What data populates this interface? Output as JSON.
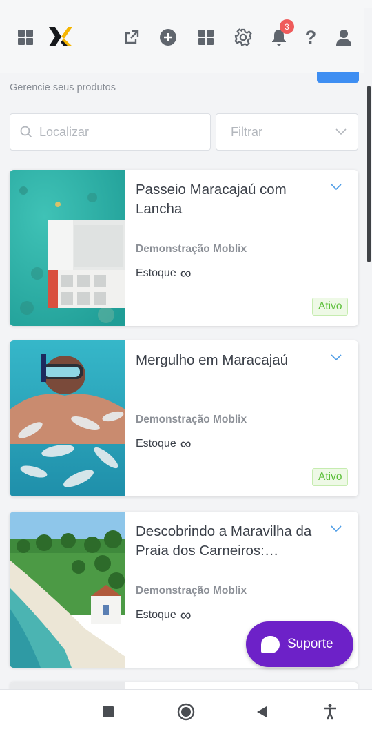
{
  "header": {
    "icons": [
      "apps-grid-icon",
      "moblix-logo",
      "external-link-icon",
      "add-circle-icon",
      "modules-grid-icon",
      "settings-gear-icon",
      "bell-icon",
      "help-icon",
      "user-icon"
    ],
    "notification_count": "3",
    "help_label": "?"
  },
  "page": {
    "subtitle": "Gerencie seus produtos"
  },
  "search": {
    "placeholder": "Localizar",
    "value": ""
  },
  "filter": {
    "placeholder": "Filtrar"
  },
  "products": [
    {
      "title": "Passeio Maracajaú com Lancha",
      "brand": "Demonstração Moblix",
      "stock_label": "Estoque",
      "stock_value": "∞",
      "status": "Ativo"
    },
    {
      "title": "Mergulho em Maracajaú",
      "brand": "Demonstração Moblix",
      "stock_label": "Estoque",
      "stock_value": "∞",
      "status": "Ativo"
    },
    {
      "title": "Descobrindo a Maravilha da Praia dos Carneiros: Passeio Encantador",
      "brand": "Demonstração Moblix",
      "stock_label": "Estoque",
      "stock_value": "∞",
      "status": ""
    }
  ],
  "support_button": {
    "label": "Suporte"
  },
  "colors": {
    "accent_blue": "#3e8ef2",
    "support_purple": "#6d21c8",
    "status_green": "#5cbf3a",
    "badge_red": "#ef5b5b"
  },
  "android_nav": [
    "recents-square-icon",
    "home-circle-icon",
    "back-triangle-icon",
    "accessibility-icon"
  ]
}
